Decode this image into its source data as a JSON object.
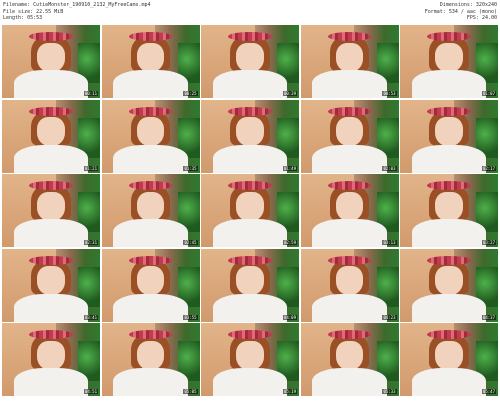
{
  "header": {
    "filename": "Filename: CutieMonster_190910_2132_MyFreeCams.mp4",
    "filesize": "File size: 22.55 MiB",
    "length": "Length: 05:53",
    "dimensions": "Dimensions: 320x240",
    "format": "Format: 534 / aac (mono)",
    "fps": "FPS: 24.00"
  },
  "thumbnails": [
    {
      "time": "00:11"
    },
    {
      "time": "00:25"
    },
    {
      "time": "00:39"
    },
    {
      "time": "00:53"
    },
    {
      "time": "01:07"
    },
    {
      "time": "01:21"
    },
    {
      "time": "01:35"
    },
    {
      "time": "01:49"
    },
    {
      "time": "02:03"
    },
    {
      "time": "02:17"
    },
    {
      "time": "02:31"
    },
    {
      "time": "02:45"
    },
    {
      "time": "02:59"
    },
    {
      "time": "03:13"
    },
    {
      "time": "03:27"
    },
    {
      "time": "03:41"
    },
    {
      "time": "03:55"
    },
    {
      "time": "04:09"
    },
    {
      "time": "04:23"
    },
    {
      "time": "04:37"
    },
    {
      "time": "04:51"
    },
    {
      "time": "05:05"
    },
    {
      "time": "05:19"
    },
    {
      "time": "05:33"
    },
    {
      "time": "05:47"
    }
  ]
}
